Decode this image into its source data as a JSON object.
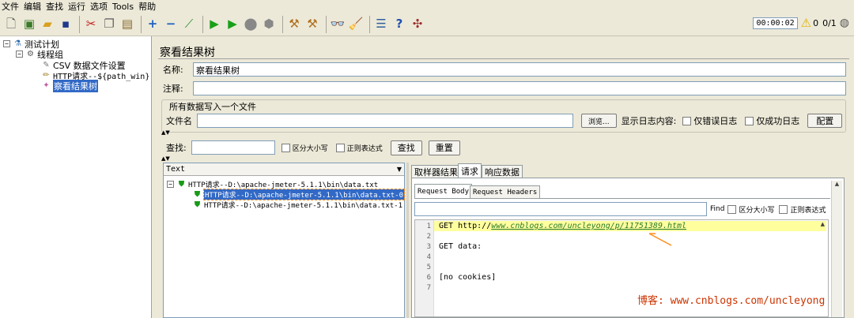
{
  "menu": [
    "文件",
    "编辑",
    "查找",
    "运行",
    "选项",
    "Tools",
    "帮助"
  ],
  "toolbar": {
    "icons": [
      "new-icon",
      "templates-icon",
      "open-icon",
      "save-icon",
      "cut-icon",
      "copy-icon",
      "paste-icon",
      "expand-icon",
      "collapse-icon",
      "toggle-icon",
      "start-icon",
      "start-no-pause-icon",
      "stop-icon",
      "shutdown-icon",
      "clear-icon",
      "clear-all-icon",
      "search-icon",
      "reset-search-icon",
      "function-helper-icon",
      "help-icon",
      "remote-icon"
    ],
    "timer": "00:00:02",
    "warning_count": "0",
    "threads": "0/1"
  },
  "tree": {
    "root": "测试计划",
    "thread_group": "线程组",
    "csv": "CSV 数据文件设置",
    "http": "HTTP请求--${path_win}",
    "view_results": "察看结果树"
  },
  "panel": {
    "title": "察看结果树",
    "name_label": "名称:",
    "name_value": "察看结果树",
    "comment_label": "注释:",
    "file_section": "所有数据写入一个文件",
    "file_label": "文件名",
    "browse": "浏览...",
    "log_label": "显示日志内容:",
    "errors_only": "仅错误日志",
    "success_only": "仅成功日志",
    "configure": "配置",
    "search_label": "查找:",
    "case_sensitive": "区分大小写",
    "regex": "正则表达式",
    "search_btn": "查找",
    "reset_btn": "重置",
    "renderer": "Text",
    "results": {
      "parent": "HTTP请求--D:\\apache-jmeter-5.1.1\\bin\\data.txt",
      "child0": "HTTP请求--D:\\apache-jmeter-5.1.1\\bin\\data.txt-0",
      "child1": "HTTP请求--D:\\apache-jmeter-5.1.1\\bin\\data.txt-1"
    },
    "tabs": [
      "取样器结果",
      "请求",
      "响应数据"
    ],
    "subtabs": [
      "Request Body",
      "Request Headers"
    ],
    "find_label": "Find",
    "find_case": "区分大小写",
    "find_regex": "正则表达式",
    "code": {
      "line1_prefix": "GET http://",
      "line1_url": "www.cnblogs.com/uncleyong/p/11751389.html",
      "line3": "GET data:",
      "line6": "[no cookies]",
      "line_numbers": [
        "1",
        "2",
        "3",
        "4",
        "5",
        "6",
        "7"
      ]
    },
    "watermark": "博客: www.cnblogs.com/uncleyong"
  },
  "colors": {
    "selection": "#3169c6",
    "highlight_line": "#ffff9e",
    "watermark": "#cc3300",
    "annotation": "#ff8c1a"
  }
}
